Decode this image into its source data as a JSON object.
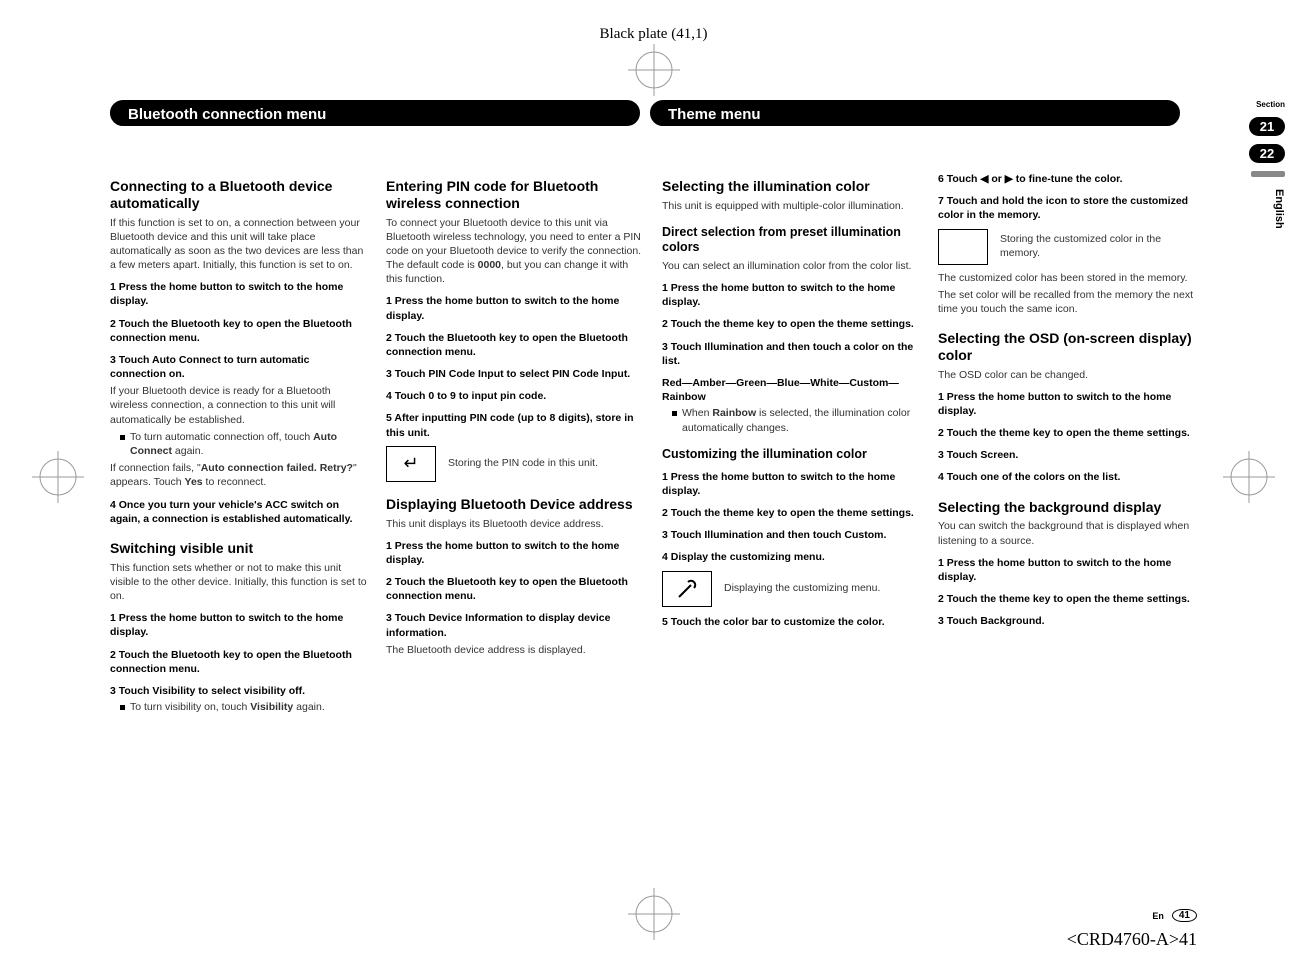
{
  "plate": "Black plate (41,1)",
  "headers": {
    "left": "Bluetooth connection menu",
    "right": "Theme menu"
  },
  "side": {
    "section_label": "Section",
    "n1": "21",
    "n2": "22",
    "lang": "English"
  },
  "footer": {
    "lang": "En",
    "page": "41"
  },
  "docid": "<CRD4760-A>41",
  "c1": {
    "h1": "Connecting to a Bluetooth device automatically",
    "p1": "If this function is set to on, a connection between your Bluetooth device and this unit will take place automatically as soon as the two devices are less than a few meters apart. Initially, this function is set to on.",
    "s1": "1   Press the home button to switch to the home display.",
    "s2": "2   Touch the Bluetooth key to open the Bluetooth connection menu.",
    "s3": "3   Touch Auto Connect to turn automatic connection on.",
    "p2": "If your Bluetooth device is ready for a Bluetooth wireless connection, a connection to this unit will automatically be established.",
    "b1a": "To turn automatic connection off, touch ",
    "b1b": "Auto Connect",
    "b1c": " again.",
    "p3a": "If connection fails, \"",
    "p3b": "Auto connection failed. Retry?",
    "p3c": "\" appears. Touch ",
    "p3d": "Yes",
    "p3e": " to reconnect.",
    "s4": "4   Once you turn your vehicle's ACC switch on again, a connection is established automatically.",
    "h2": "Switching visible unit",
    "p4": "This function sets whether or not to make this unit visible to the other device. Initially, this function is set to on.",
    "s5": "1   Press the home button to switch to the home display.",
    "s6": "2   Touch the Bluetooth key to open the Bluetooth connection menu.",
    "s7": "3   Touch Visibility to select visibility off.",
    "b2a": "To turn visibility on, touch ",
    "b2b": "Visibility",
    "b2c": " again."
  },
  "c2": {
    "h1": "Entering PIN code for Bluetooth wireless connection",
    "p1a": "To connect your Bluetooth device to this unit via Bluetooth wireless technology, you need to enter a PIN code on your Bluetooth device to verify the connection. The default code is ",
    "p1b": "0000",
    "p1c": ", but you can change it with this function.",
    "s1": "1   Press the home button to switch to the home display.",
    "s2": "2   Touch the Bluetooth key to open the Bluetooth connection menu.",
    "s3": "3   Touch PIN Code Input to select PIN Code Input.",
    "s4": "4   Touch 0 to 9 to input pin code.",
    "s5": "5   After inputting PIN code (up to 8 digits), store in this unit.",
    "icon1": "↵",
    "cap1": "Storing the PIN code in this unit.",
    "h2": "Displaying Bluetooth Device address",
    "p2": "This unit displays its Bluetooth device address.",
    "s6": "1   Press the home button to switch to the home display.",
    "s7": "2   Touch the Bluetooth key to open the Bluetooth connection menu.",
    "s8": "3   Touch Device Information to display device information.",
    "p3": "The Bluetooth device address is displayed."
  },
  "c3": {
    "h1": "Selecting the illumination color",
    "p1": "This unit is equipped with multiple-color illumination.",
    "h2": "Direct selection from preset illumination colors",
    "p2": "You can select an illumination color from the color list.",
    "s1": "1   Press the home button to switch to the home display.",
    "s2": "2   Touch the theme key to open the theme settings.",
    "s3": "3   Touch Illumination and then touch a color on the list.",
    "colors_a": "Red",
    "colors_b": "Amber",
    "colors_c": "Green",
    "colors_d": "Blue",
    "colors_e": "White",
    "colors_f": "Custom",
    "colors_g": "Rainbow",
    "b1a": "When ",
    "b1b": "Rainbow",
    "b1c": " is selected, the illumination color automatically changes.",
    "h3": "Customizing the illumination color",
    "s4": "1   Press the home button to switch to the home display.",
    "s5": "2   Touch the theme key to open the theme settings.",
    "s6": "3   Touch Illumination and then touch Custom.",
    "s7": "4   Display the customizing menu.",
    "icon1": "🔧",
    "cap1": "Displaying the customizing menu.",
    "s8": "5   Touch the color bar to customize the color."
  },
  "c4": {
    "s6": "6   Touch ◀ or ▶ to fine-tune the color.",
    "s7": "7   Touch and hold the icon to store the customized color in the memory.",
    "cap1": "Storing the customized color in the memory.",
    "p1": "The customized color has been stored in the memory.",
    "p2": "The set color will be recalled from the memory the next time you touch the same icon.",
    "h1": "Selecting the OSD (on-screen display) color",
    "p3": "The OSD color can be changed.",
    "s1": "1   Press the home button to switch to the home display.",
    "s2": "2   Touch the theme key to open the theme settings.",
    "s3": "3   Touch Screen.",
    "s4": "4   Touch one of the colors on the list.",
    "h2": "Selecting the background display",
    "p4": "You can switch the background that is displayed when listening to a source.",
    "s5": "1   Press the home button to switch to the home display.",
    "s8": "2   Touch the theme key to open the theme settings.",
    "s9": "3   Touch Background."
  }
}
